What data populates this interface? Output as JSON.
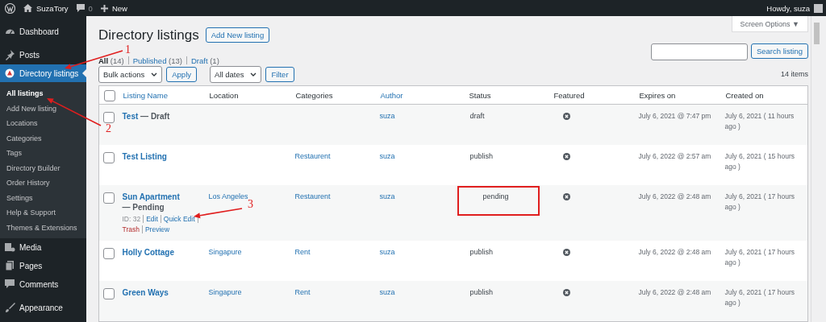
{
  "admin_bar": {
    "site_name": "SuzaTory",
    "comments_count": "0",
    "new_label": "New",
    "greeting": "Howdy, suza"
  },
  "sidebar": {
    "items": [
      {
        "label": "Dashboard",
        "current": false
      },
      {
        "label": "Posts",
        "current": false
      },
      {
        "label": "Directory listings",
        "current": true,
        "children": [
          {
            "label": "All listings",
            "selected": true
          },
          {
            "label": "Add New listing",
            "selected": false
          },
          {
            "label": "Locations",
            "selected": false
          },
          {
            "label": "Categories",
            "selected": false
          },
          {
            "label": "Tags",
            "selected": false
          },
          {
            "label": "Directory Builder",
            "selected": false
          },
          {
            "label": "Order History",
            "selected": false
          },
          {
            "label": "Settings",
            "selected": false
          },
          {
            "label": "Help & Support",
            "selected": false
          },
          {
            "label": "Themes & Extensions",
            "selected": false
          }
        ]
      },
      {
        "label": "Media",
        "current": false
      },
      {
        "label": "Pages",
        "current": false
      },
      {
        "label": "Comments",
        "current": false
      },
      {
        "label": "Appearance",
        "current": false
      }
    ]
  },
  "screen_options": "Screen Options ▼",
  "page_title": "Directory listings",
  "add_new_button": "Add New listing",
  "filters": [
    {
      "label": "All",
      "count": "(14)",
      "selected": true
    },
    {
      "label": "Published",
      "count": "(13)",
      "selected": false
    },
    {
      "label": "Draft",
      "count": "(1)",
      "selected": false
    }
  ],
  "search_button": "Search listing",
  "bulk_actions": "Bulk actions",
  "apply_button": "Apply",
  "date_filter": "All dates",
  "filter_button": "Filter",
  "item_count": "14 items",
  "table": {
    "all_checked": false,
    "columns": [
      {
        "label": "Listing Name",
        "sortable": true
      },
      {
        "label": "Location",
        "sortable": false
      },
      {
        "label": "Categories",
        "sortable": false
      },
      {
        "label": "Author",
        "sortable": true
      },
      {
        "label": "Status",
        "sortable": false
      },
      {
        "label": "Featured",
        "sortable": false
      },
      {
        "label": "Expires on",
        "sortable": false
      },
      {
        "label": "Created on",
        "sortable": false
      }
    ],
    "rows": [
      {
        "checked": false,
        "title": "Test",
        "post_state": "— Draft",
        "location": "",
        "category": "",
        "author": "suza",
        "status": "draft",
        "status_highlighted": false,
        "featured": false,
        "expires": "July 6, 2021 @ 7:47 pm",
        "created": "July 6, 2021 ( 11 hours ago )"
      },
      {
        "checked": false,
        "title": "Test Listing",
        "location": "",
        "category": "Restaurent",
        "author": "suza",
        "status": "publish",
        "status_highlighted": false,
        "featured": false,
        "expires": "July 6, 2022 @ 2:57 am",
        "created": "July 6, 2021 ( 15 hours ago )"
      },
      {
        "checked": false,
        "title": "Sun Apartment",
        "post_state": "— Pending",
        "location": "Los Angeles",
        "category": "Restaurent",
        "author": "suza",
        "status": "pending",
        "status_highlighted": true,
        "featured": false,
        "expires": "July 6, 2022 @ 2:48 am",
        "created": "July 6, 2021 ( 17 hours ago )",
        "row_actions": [
          {
            "label": "ID: 32",
            "kind": "id"
          },
          {
            "label": "Edit",
            "kind": "link"
          },
          {
            "label": "Quick Edit",
            "kind": "link"
          },
          {
            "label": "Trash",
            "kind": "trash"
          },
          {
            "label": "Preview",
            "kind": "link"
          }
        ]
      },
      {
        "checked": false,
        "title": "Holly Cottage",
        "location": "Singapure",
        "category": "Rent",
        "author": "suza",
        "status": "publish",
        "status_highlighted": false,
        "featured": false,
        "expires": "July 6, 2022 @ 2:48 am",
        "created": "July 6, 2021 ( 17 hours ago )"
      },
      {
        "checked": false,
        "title": "Green Ways",
        "location": "Singapure",
        "category": "Rent",
        "author": "suza",
        "status": "publish",
        "status_highlighted": false,
        "featured": false,
        "expires": "July 6, 2022 @ 2:48 am",
        "created": "July 6, 2021 ( 17 hours ago )"
      }
    ]
  },
  "annotations": [
    {
      "label": "1"
    },
    {
      "label": "2"
    },
    {
      "label": "3"
    }
  ]
}
